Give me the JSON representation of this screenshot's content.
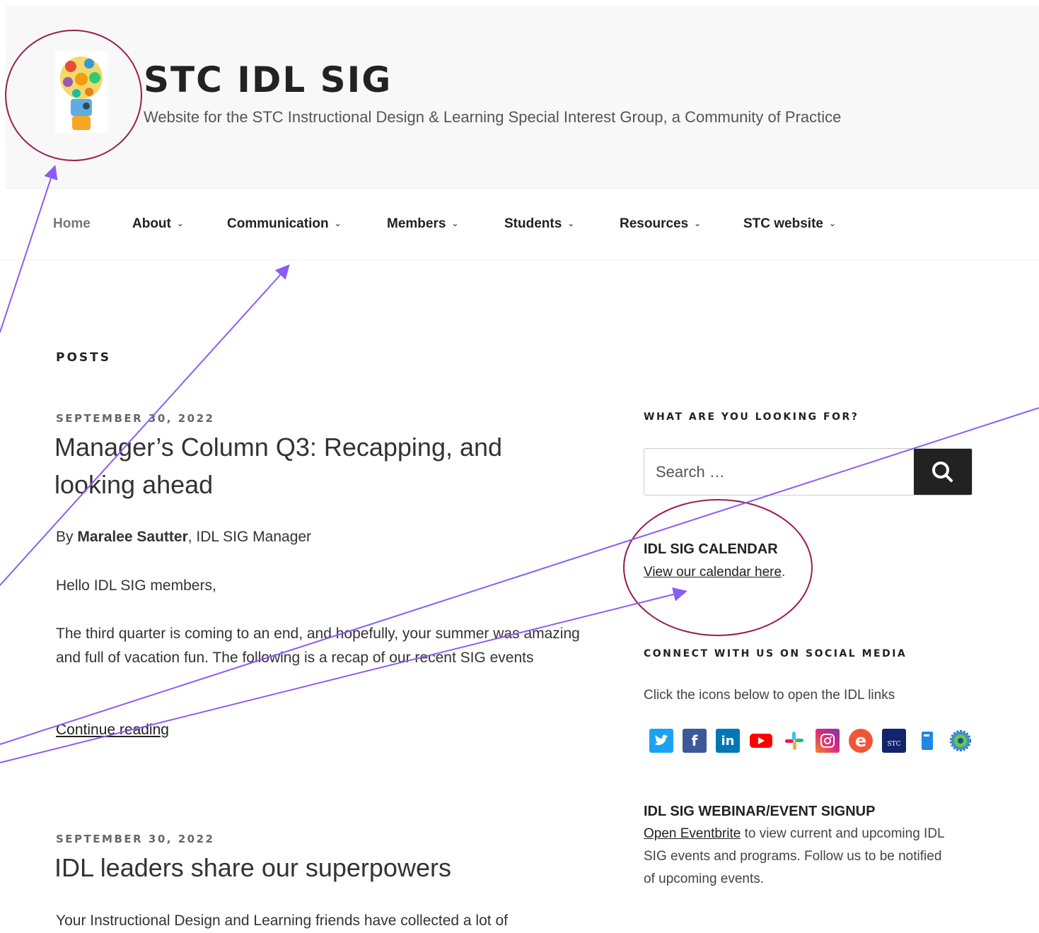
{
  "site": {
    "title": "STC IDL SIG",
    "description": "Website for the STC Instructional Design & Learning Special Interest Group, a Community of Practice"
  },
  "nav": {
    "items": [
      {
        "label": "Home"
      },
      {
        "label": "About"
      },
      {
        "label": "Communication"
      },
      {
        "label": "Members"
      },
      {
        "label": "Students"
      },
      {
        "label": "Resources"
      },
      {
        "label": "STC website"
      }
    ]
  },
  "main": {
    "heading": "POSTS",
    "posts": [
      {
        "date": "SEPTEMBER 30, 2022",
        "title": "Manager’s Column Q3: Recapping, and looking ahead",
        "byline_prefix": "By ",
        "byline_author": "Maralee Sautter",
        "byline_suffix": ", IDL SIG Manager",
        "greeting": "Hello IDL SIG members,",
        "excerpt": "The third quarter is coming to an end, and hopefully, your summer was amazing and full of vacation fun. The following is a recap of our recent SIG events",
        "continue_label": "Continue reading"
      },
      {
        "date": "SEPTEMBER 30, 2022",
        "title": "IDL leaders share our superpowers",
        "excerpt": "Your Instructional Design and Learning friends have collected a lot of"
      }
    ]
  },
  "sidebar": {
    "search": {
      "heading": "WHAT ARE YOU LOOKING FOR?",
      "placeholder": "Search …"
    },
    "calendar": {
      "heading": "IDL SIG CALENDAR",
      "link": "View our calendar here",
      "suffix": "."
    },
    "social": {
      "heading": "CONNECT WITH US ON SOCIAL MEDIA",
      "text": "Click the icons below to open the IDL links",
      "icons": [
        "twitter-icon",
        "facebook-icon",
        "linkedin-icon",
        "youtube-icon",
        "slack-icon",
        "instagram-icon",
        "eventbrite-icon",
        "stc-icon",
        "notebook-icon",
        "globe-icon"
      ]
    },
    "webinar": {
      "heading": "IDL SIG WEBINAR/EVENT SIGNUP",
      "link": "Open Eventbrite",
      "text": " to view current and upcoming IDL SIG events and programs. Follow us to be notified of upcoming events."
    }
  },
  "annotation": {
    "color": "#8a5cf6",
    "circle_color": "#9b1c52"
  }
}
